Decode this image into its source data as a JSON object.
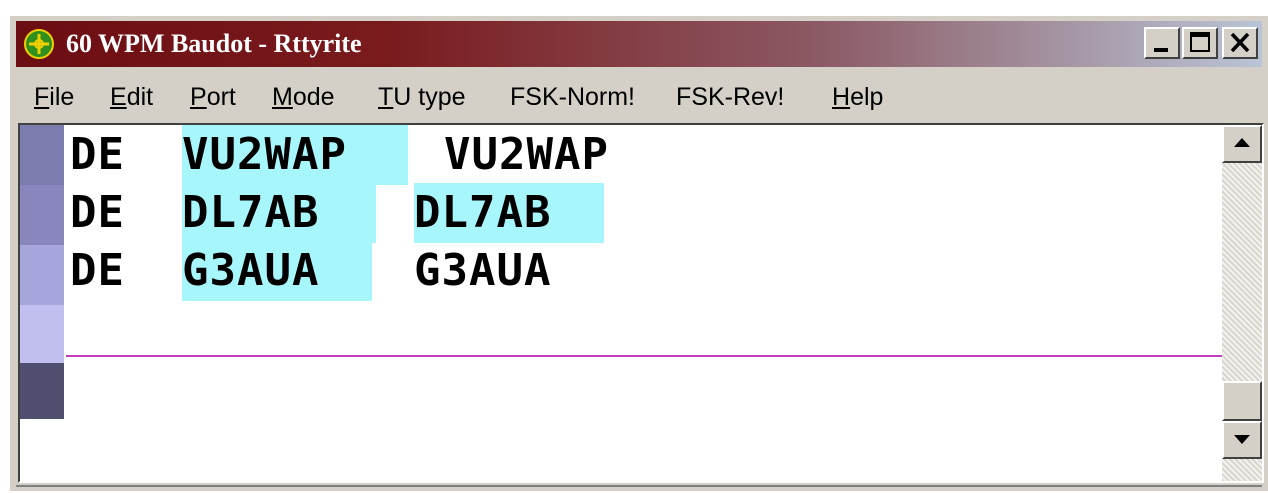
{
  "window": {
    "title": "60 WPM Baudot - Rttyrite",
    "accent_colors": {
      "titlebar_start": "#6b0d12",
      "titlebar_end": "#b9c4d6",
      "highlight": "#a6f6fb",
      "divider": "#c040c0"
    }
  },
  "controls": {
    "minimize_icon": "minimize-icon",
    "maximize_icon": "maximize-icon",
    "close_icon": "close-icon"
  },
  "menu": [
    {
      "pre": "",
      "key": "F",
      "post": "ile"
    },
    {
      "pre": "",
      "key": "E",
      "post": "dit"
    },
    {
      "pre": "",
      "key": "P",
      "post": "ort"
    },
    {
      "pre": "",
      "key": "M",
      "post": "ode"
    },
    {
      "pre": "",
      "key": "T",
      "post": "U type"
    },
    {
      "pre": "FSK-Norm!",
      "key": "",
      "post": ""
    },
    {
      "pre": "FSK-Rev!",
      "key": "",
      "post": ""
    },
    {
      "pre": "",
      "key": "H",
      "post": "elp"
    }
  ],
  "receive_lines": [
    [
      {
        "text": "DE",
        "hl": false
      },
      {
        "text": "VU2WAP",
        "hl": true
      },
      {
        "text": "VU2WAP",
        "hl": false
      }
    ],
    [
      {
        "text": "DE",
        "hl": false
      },
      {
        "text": "DL7AB",
        "hl": true
      },
      {
        "text": "DL7AB",
        "hl": true
      }
    ],
    [
      {
        "text": "DE",
        "hl": false
      },
      {
        "text": "G3AUA",
        "hl": true
      },
      {
        "text": "G3AUA",
        "hl": false
      }
    ]
  ],
  "gutter_colors": [
    "#7d7cae",
    "#8886bc",
    "#a6a5dc",
    "#c0bff0",
    "#4f4e6e"
  ]
}
